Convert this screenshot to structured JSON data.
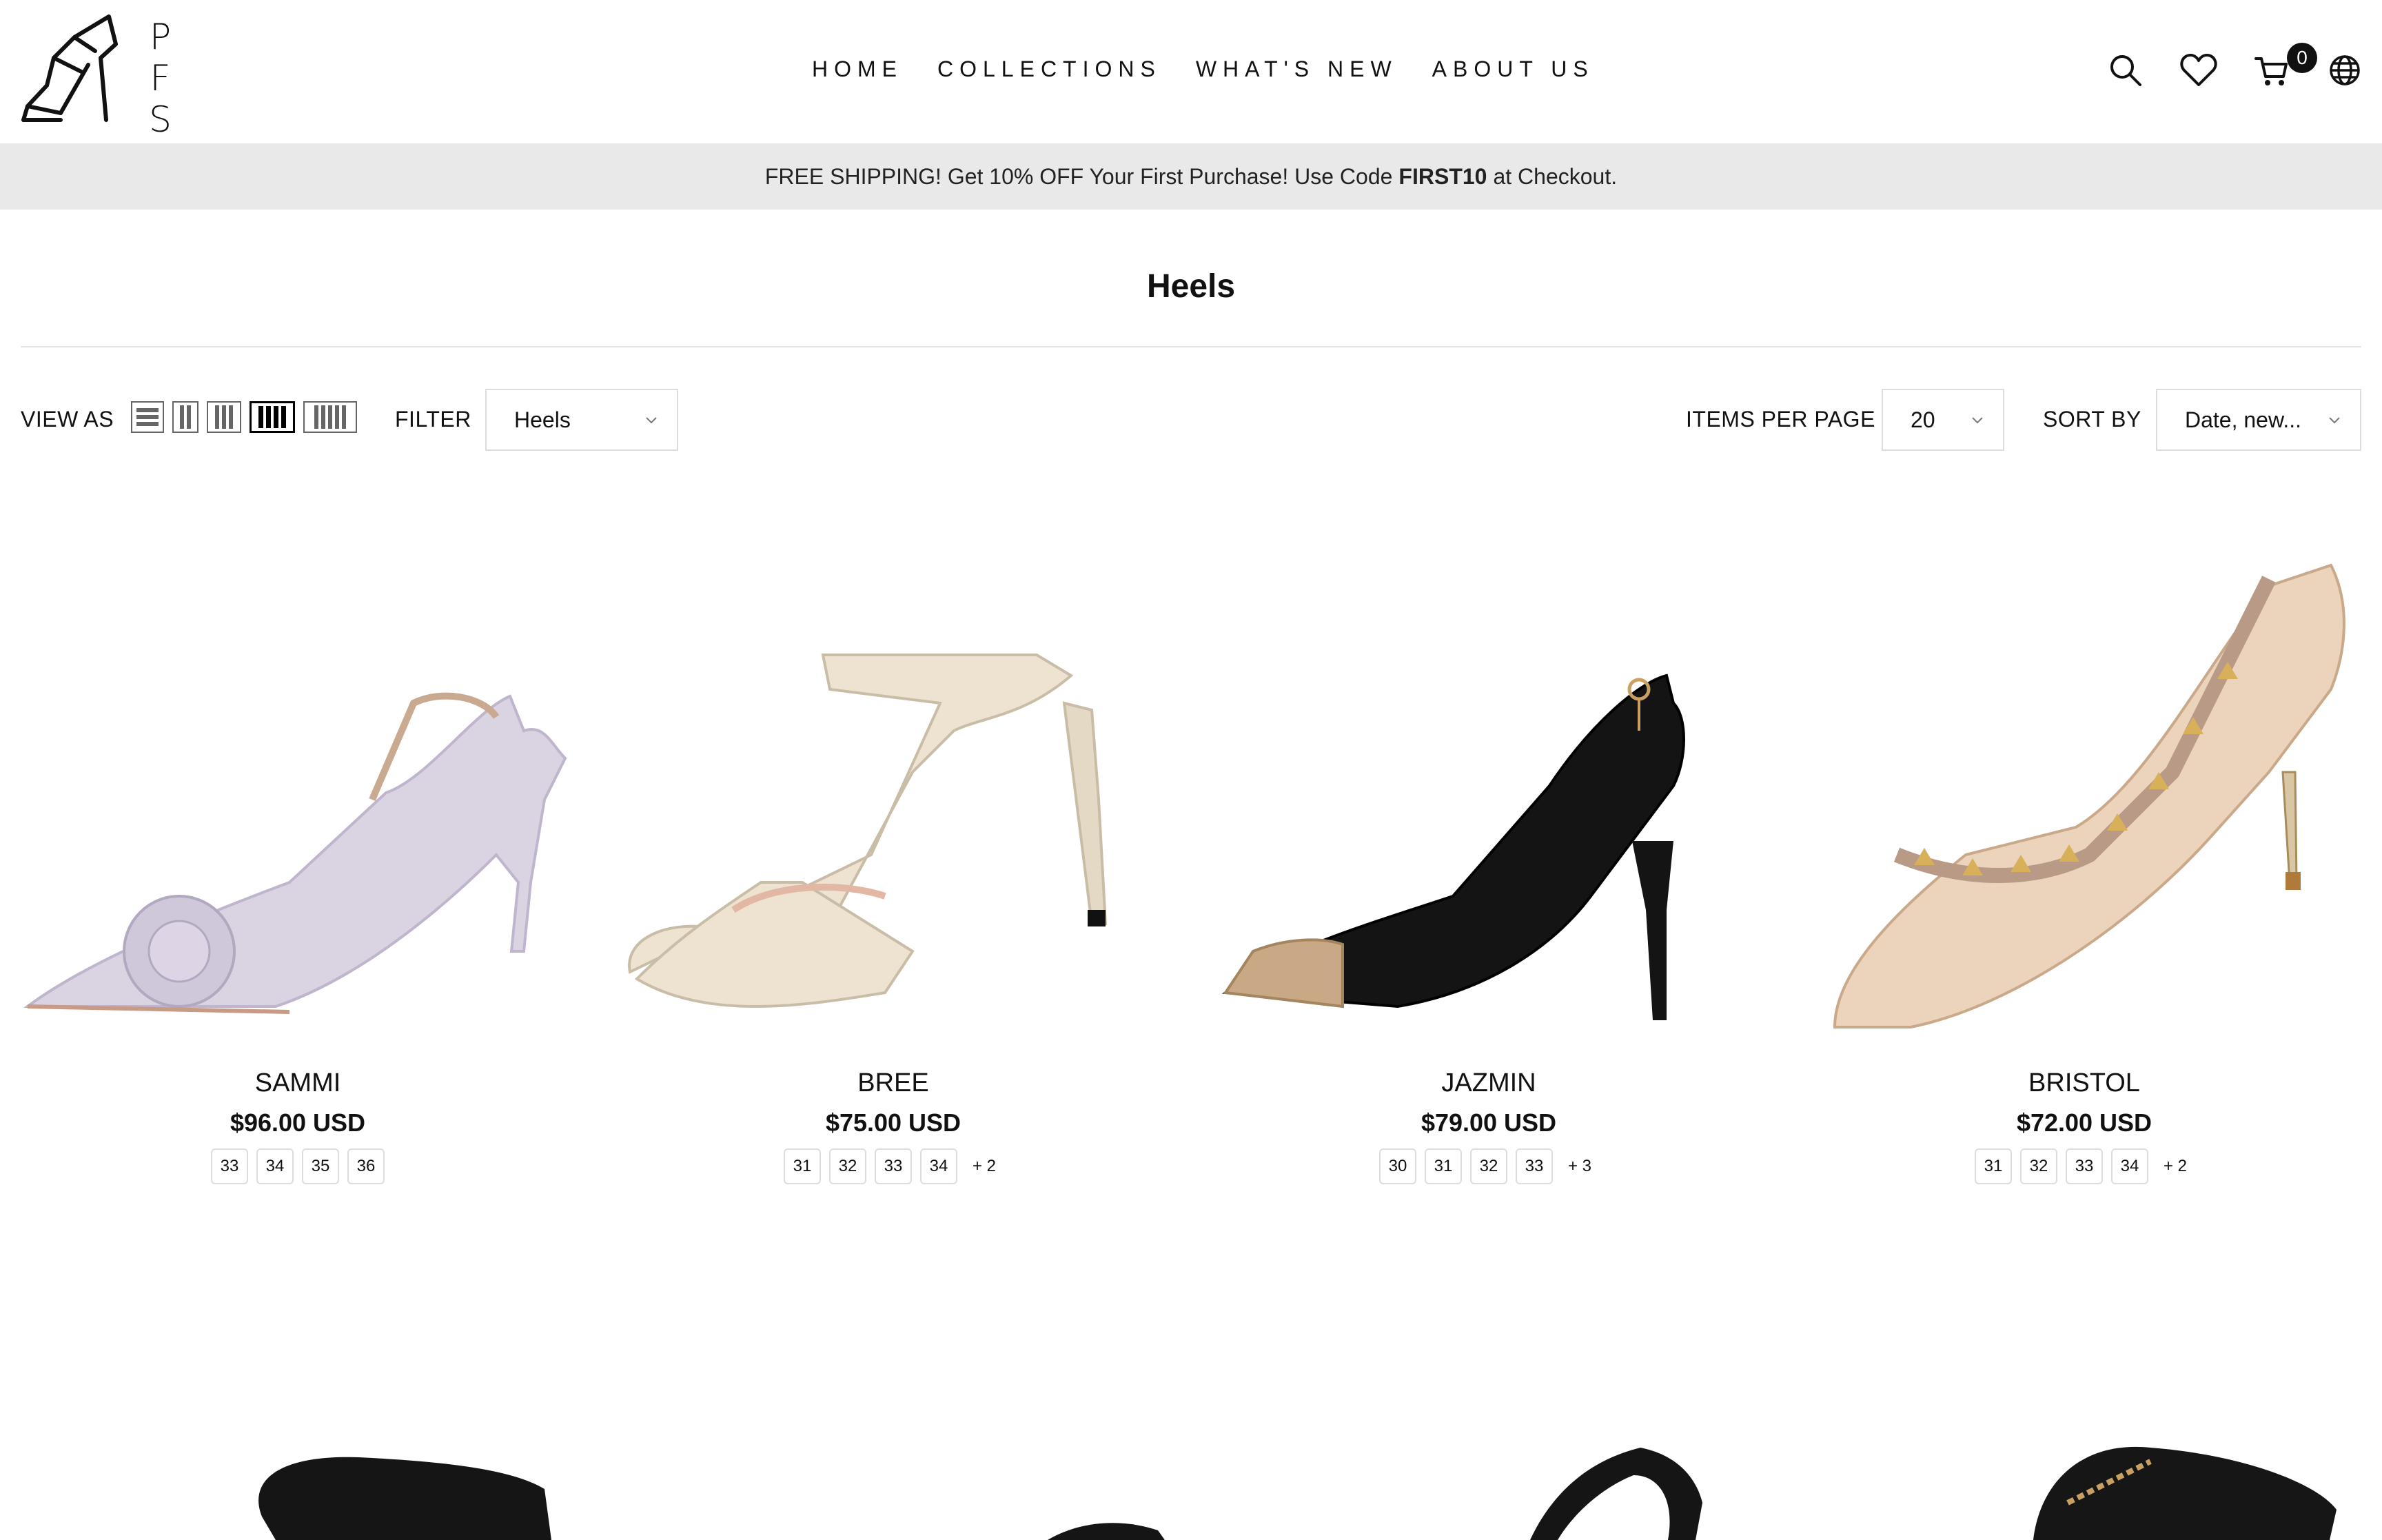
{
  "brand": {
    "letters": [
      "P",
      "F",
      "S"
    ]
  },
  "nav": [
    "HOME",
    "COLLECTIONS",
    "WHAT'S NEW",
    "ABOUT US"
  ],
  "header_icons": [
    "search-icon",
    "heart-icon",
    "cart-icon",
    "globe-icon"
  ],
  "cart_count": "0",
  "announcement": {
    "before": "FREE SHIPPING! Get 10% OFF Your First Purchase! Use Code",
    "code": "FIRST10",
    "after": "at Checkout."
  },
  "page_title": "Heels",
  "toolbar": {
    "view_as_label": "VIEW AS",
    "filter_label": "FILTER",
    "filter_value": "Heels",
    "items_per_page_label": "ITEMS PER PAGE",
    "items_per_page_value": "20",
    "sort_by_label": "SORT BY",
    "sort_by_value": "Date, new..."
  },
  "products": [
    {
      "name": "SAMMI",
      "price": "$96.00 USD",
      "sizes": [
        "33",
        "34",
        "35",
        "36"
      ],
      "more": "",
      "color": "#d9d3e2"
    },
    {
      "name": "BREE",
      "price": "$75.00 USD",
      "sizes": [
        "31",
        "32",
        "33",
        "34"
      ],
      "more": "+ 2",
      "color": "#ede3d0"
    },
    {
      "name": "JAZMIN",
      "price": "$79.00 USD",
      "sizes": [
        "30",
        "31",
        "32",
        "33"
      ],
      "more": "+ 3",
      "color": "#141414"
    },
    {
      "name": "BRISTOL",
      "price": "$72.00 USD",
      "sizes": [
        "31",
        "32",
        "33",
        "34"
      ],
      "more": "+ 2",
      "color": "#ecd3bc"
    }
  ]
}
